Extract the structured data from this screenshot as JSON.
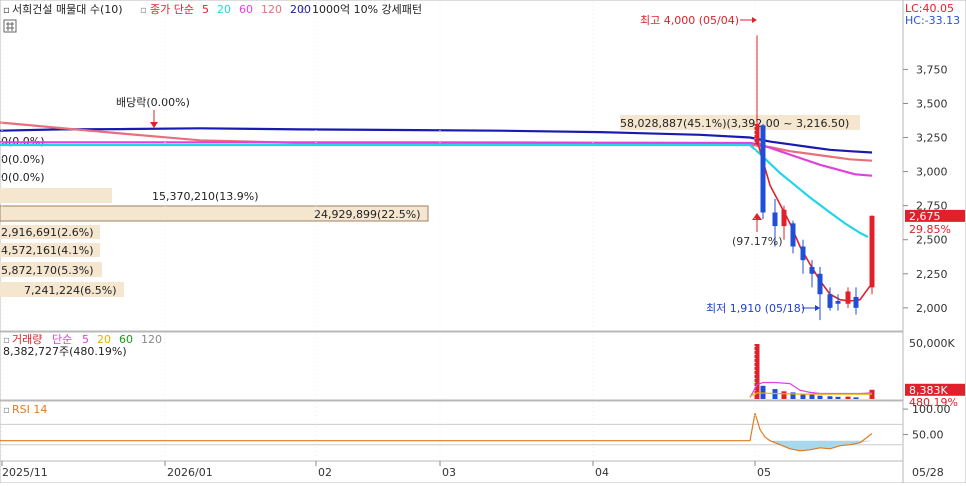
{
  "toolbar": {
    "stock_name": "서희건설 매물대 수(10)",
    "ma_label": "종가 단순",
    "ma_periods": [
      "5",
      "20",
      "60",
      "120",
      "200"
    ],
    "ma_colors": [
      "#e0202a",
      "#22d5e5",
      "#e040e0",
      "#e8707a",
      "#1a1ab0"
    ],
    "pattern_label": "1000억 10% 강세패턴"
  },
  "corner": {
    "lc": "LC:40.05",
    "hc": "HC:-33.13"
  },
  "price_panel": {
    "y_ticks": [
      "3,750",
      "3,500",
      "3,250",
      "3,000",
      "2,750",
      "2,500",
      "2,250",
      "2,000"
    ],
    "y_tick_values": [
      3750,
      3500,
      3250,
      3000,
      2750,
      2500,
      2250,
      2000
    ],
    "ylim": [
      1830,
      4230
    ],
    "current_price": "2,675",
    "current_value": 2675,
    "current_change": "29.85%",
    "high_annotation": "최고 4,000 (05/04)",
    "low_annotation": "최저 1,910 (05/18)",
    "pct_annotation": "(97.17%)",
    "dividend_label": "배당락(0.00%)",
    "volume_profile": [
      {
        "label": "58,028,887(45.1%)(3,392.00 ~ 3,216.50)",
        "share": 45.1
      },
      {
        "label": "0(0.0%)",
        "share": 0
      },
      {
        "label": "0(0.0%)",
        "share": 0
      },
      {
        "label": "0(0.0%)",
        "share": 0
      },
      {
        "label": "15,370,210(13.9%)",
        "share": 13.9
      },
      {
        "label": "24,929,899(22.5%)",
        "share": 22.5
      },
      {
        "label": "2,916,691(2.6%)",
        "share": 2.6
      },
      {
        "label": "4,572,161(4.1%)",
        "share": 4.1
      },
      {
        "label": "5,872,170(5.3%)",
        "share": 5.3
      },
      {
        "label": "7,241,224(6.5%)",
        "share": 6.5
      }
    ]
  },
  "volume_panel": {
    "label": "거래량",
    "ma_label": "단순",
    "ma_periods": [
      "5",
      "20",
      "60",
      "120"
    ],
    "ma_colors": [
      "#e040e0",
      "#e8b000",
      "#12a012",
      "#888888"
    ],
    "summary": "8,382,727주(480.19%)",
    "y_tick": "50,000K",
    "current": "8,383K",
    "current_pct": "480.19%"
  },
  "rsi_panel": {
    "label": "RSI 14",
    "y_ticks": [
      "100.00",
      "50.00"
    ],
    "y_tick_values": [
      100,
      50
    ]
  },
  "x_axis": {
    "labels": [
      "2025/11",
      "2026/01",
      "02",
      "03",
      "04",
      "05",
      "05/28"
    ]
  },
  "chart_data": {
    "type": "candlestick",
    "x_labels": [
      "2025/11",
      "2026/01",
      "02",
      "03",
      "04",
      "05",
      "05/28"
    ],
    "ma_series": [
      {
        "name": "200",
        "color": "#1a1ab0",
        "values": [
          3300,
          3310,
          3312,
          3318,
          3310,
          3305,
          3300,
          3290,
          3270,
          3250,
          3220,
          3200,
          3180,
          3160,
          3150,
          3140
        ]
      },
      {
        "name": "120",
        "color": "#e8707a",
        "values": [
          3360,
          3320,
          3280,
          3230,
          3210,
          3210,
          3210,
          3205,
          3200,
          3195,
          3180,
          3150,
          3130,
          3110,
          3090,
          3080
        ]
      },
      {
        "name": "60",
        "color": "#e040e0",
        "values": [
          3215,
          3215,
          3215,
          3212,
          3210,
          3200,
          3150,
          3100,
          3050,
          3010,
          2980,
          2970
        ]
      },
      {
        "name": "20",
        "color": "#22d5e5",
        "values": [
          3195,
          3195,
          3195,
          3195,
          3195,
          3130,
          2990,
          2900,
          2810,
          2700,
          2620,
          2550,
          2520
        ]
      },
      {
        "name": "5",
        "color": "#e0202a",
        "values": [
          3230,
          2900,
          2760,
          2620,
          2450,
          2320,
          2200,
          2100,
          2060,
          2050,
          2060,
          2180
        ]
      }
    ],
    "candles": [
      {
        "o": 3200,
        "h": 4000,
        "l": 3200,
        "c": 3350
      },
      {
        "o": 3340,
        "h": 3350,
        "l": 2650,
        "c": 2700
      },
      {
        "o": 2700,
        "h": 2800,
        "l": 2450,
        "c": 2600
      },
      {
        "o": 2600,
        "h": 2750,
        "l": 2500,
        "c": 2720
      },
      {
        "o": 2620,
        "h": 2640,
        "l": 2400,
        "c": 2450
      },
      {
        "o": 2450,
        "h": 2500,
        "l": 2250,
        "c": 2350
      },
      {
        "o": 2300,
        "h": 2350,
        "l": 2150,
        "c": 2250
      },
      {
        "o": 2250,
        "h": 2300,
        "l": 1910,
        "c": 2100
      },
      {
        "o": 2100,
        "h": 2150,
        "l": 1980,
        "c": 2000
      },
      {
        "o": 2050,
        "h": 2100,
        "l": 1980,
        "c": 2030
      },
      {
        "o": 2030,
        "h": 2150,
        "l": 2000,
        "c": 2120
      },
      {
        "o": 2080,
        "h": 2150,
        "l": 1950,
        "c": 2000
      },
      {
        "o": 2150,
        "h": 2680,
        "l": 2100,
        "c": 2675
      }
    ],
    "volume": [
      50000,
      12000,
      9000,
      7000,
      6000,
      5000,
      4000,
      3000,
      2500,
      2000,
      2200,
      1500,
      8383
    ],
    "volume_ma5": [
      1500,
      13000,
      15000,
      15000,
      14000,
      8000,
      6000,
      5000,
      5000,
      5000,
      5000,
      5500
    ],
    "volume_ma20": [
      2500,
      5500,
      5000,
      4500,
      4500,
      4500,
      4500,
      4500
    ],
    "rsi": [
      38,
      38,
      38,
      38,
      38,
      38,
      38,
      92,
      60,
      45,
      38,
      30,
      22,
      18,
      20,
      24,
      22,
      28,
      30,
      34,
      52
    ]
  }
}
